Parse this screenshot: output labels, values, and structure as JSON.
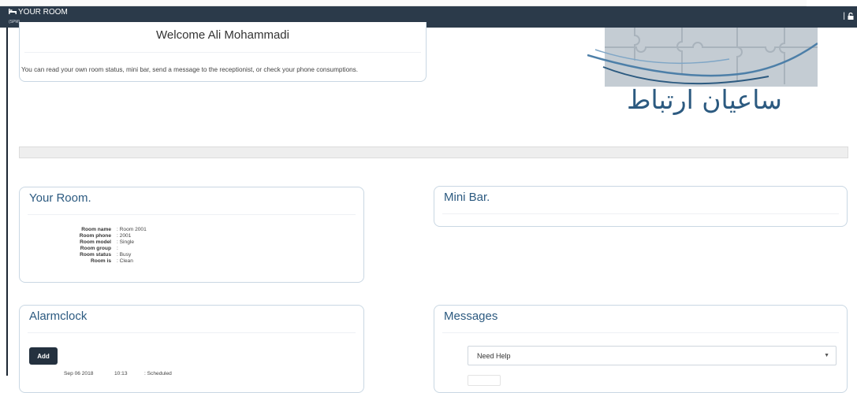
{
  "nav": {
    "title": "YOUR ROOM",
    "subtitle": "(SPM)"
  },
  "welcome": {
    "heading": "Welcome Ali Mohammadi",
    "description": "You can read your own room status, mini bar, send a message to the receptionist, or check your phone consumptions."
  },
  "logo": {
    "text": "ساعیان ارتباط"
  },
  "room": {
    "title": "Your Room.",
    "fields": [
      {
        "label": "Room name",
        "value": ": Room 2001"
      },
      {
        "label": "Room phone",
        "value": ": 2001"
      },
      {
        "label": "Room model",
        "value": ": Single"
      },
      {
        "label": "Room group",
        "value": ":"
      },
      {
        "label": "Room status",
        "value": ": Busy"
      },
      {
        "label": "Room is",
        "value": ": Clean"
      }
    ]
  },
  "minibar": {
    "title": "Mini Bar."
  },
  "alarm": {
    "title": "Alarmclock",
    "add_label": "Add",
    "rows": [
      {
        "date": "Sep 06 2018",
        "time": "10:13",
        "status": ": Scheduled"
      }
    ]
  },
  "messages": {
    "title": "Messages",
    "selected": "Need Help"
  },
  "colors": {
    "navbar": "#2b3a4a",
    "accent": "#2c5a80",
    "card_border": "#c9d7e3"
  }
}
